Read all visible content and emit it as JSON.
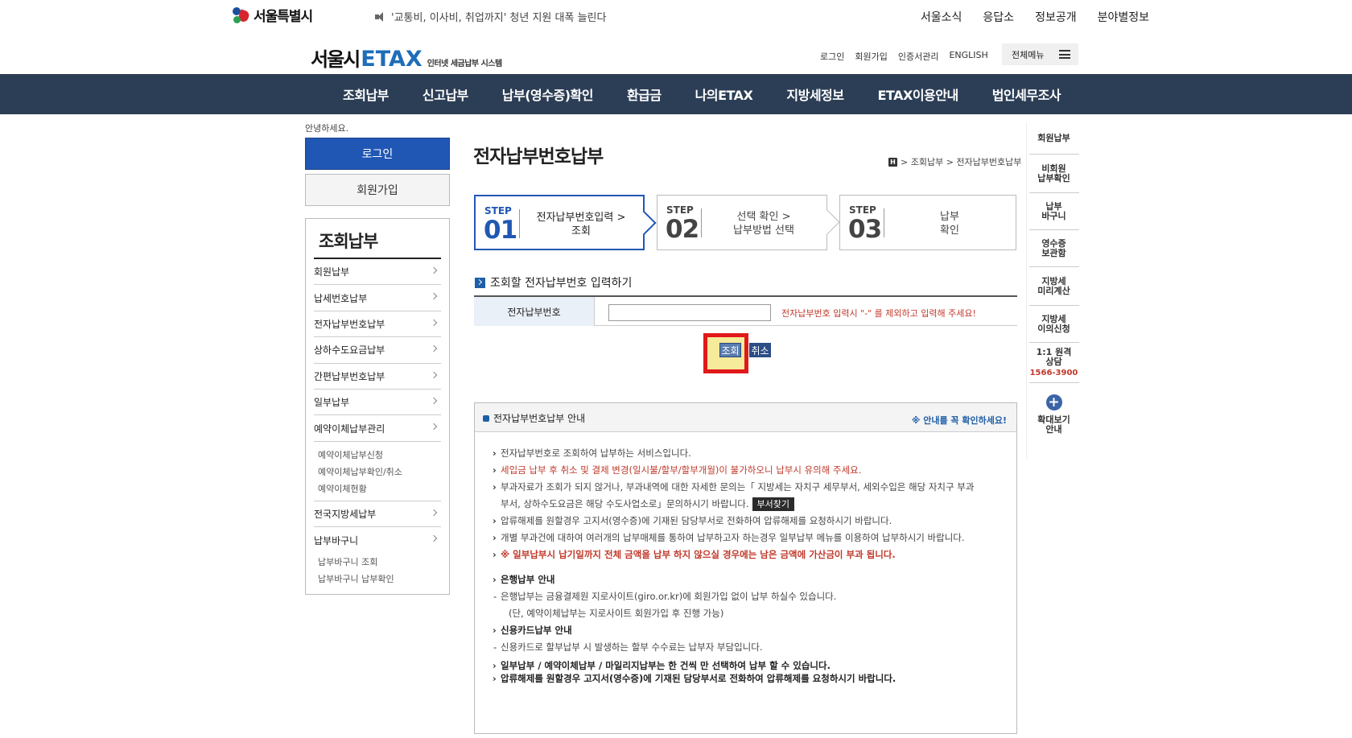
{
  "top": {
    "logo": "서울특별시",
    "notice": "'교통비, 이사비, 취업까지' 청년 지원 대폭 늘린다",
    "links": [
      "서울소식",
      "응답소",
      "정보공개",
      "분야별정보"
    ]
  },
  "header": {
    "logo_k": "서울시",
    "logo_e": "ETAX",
    "logo_sub": "인터넷 세금납부 시스템",
    "util": [
      "로그인",
      "회원가입",
      "인증서관리",
      "ENGLISH"
    ],
    "allmenu": "전체메뉴"
  },
  "gnb": [
    "조회납부",
    "신고납부",
    "납부(영수증)확인",
    "환급금",
    "나의ETAX",
    "지방세정보",
    "ETAX이용안내",
    "법인세무조사"
  ],
  "left": {
    "hello": "안녕하세요.",
    "login": "로그인",
    "join": "회원가입",
    "title": "조회납부",
    "items": [
      "회원납부",
      "납세번호납부",
      "전자납부번호납부",
      "상하수도요금납부",
      "간편납부번호납부",
      "일부납부",
      "예약이체납부관리"
    ],
    "sub1": [
      "예약이체납부신청",
      "예약이체납부확인/취소",
      "예약이체현황"
    ],
    "items2": [
      "전국지방세납부",
      "납부바구니"
    ],
    "sub2": [
      "납부바구니 조회",
      "납부바구니 납부확인"
    ]
  },
  "main": {
    "title": "전자납부번호납부",
    "breadcrumb": [
      "H",
      "> 조회납부 > 전자납부번호납부"
    ],
    "steps": [
      {
        "label": "STEP",
        "num": "01",
        "line1": "전자납부번호입력 >",
        "line2": "조회"
      },
      {
        "label": "STEP",
        "num": "02",
        "line1": "선택 확인 >",
        "line2": "납부방법 선택"
      },
      {
        "label": "STEP",
        "num": "03",
        "line1": "납부",
        "line2": "확인"
      }
    ],
    "section": "조회할 전자납부번호 입력하기",
    "field_label": "전자납부번호",
    "field_value": "",
    "hint": "전자납부번호 입력시 \"-\" 를 제외하고 입력해 주세요!",
    "search": "조회",
    "cancel": "취소"
  },
  "guide": {
    "title": "전자납부번호납부 안내",
    "warn": "※ 안내를 꼭 확인하세요!",
    "l1": "전자납부번호로 조회하여 납부하는 서비스입니다.",
    "l2": "세입금 납부 후 취소 및 결제 변경(일시불/할부/할부개월)이 불가하오니 납부시 유의해 주세요.",
    "l3a": "부과자료가 조회가 되지 않거나, 부과내역에 대한 자세한 문의는「 지방세는 자치구 세무부서, 세외수입은 해당 자치구 부과",
    "l3b": "부서, 상하수도요금은 해당 수도사업소로」문의하시기 바랍니다.",
    "l3btn": "부서찾기",
    "l4": "압류해제를 원할경우 고지서(영수증)에 기재된 담당부서로 전화하여 압류해제를 요청하시기 바랍니다.",
    "l5": "개별 부과건에 대하여 여러개의 납부매체를 통하여 납부하고자 하는경우 일부납부 메뉴를 이용하여 납부하시기 바랍니다.",
    "l6": "※ 일부납부시 납기일까지 전체 금액을 납부 하지 않으실 경우에는 남은 금액에 가산금이 부과 됩니다.",
    "bank_t": "은행납부 안내",
    "bank_1": "은행납부는 금융결제원 지로사이트(giro.or.kr)에 회원가입 없이 납부 하실수 있습니다.",
    "bank_2": "(단, 예약이체납부는 지로사이트 회원가입 후 진행 가능)",
    "card_t": "신용카드납부 안내",
    "card_1": "신용카드로 할부납부 시 발생하는 할부 수수료는 납부자 부담입니다.",
    "f1": "일부납부 / 예약이체납부 / 마일리지납부는 한 건씩 만 선택하여 납부 할 수 있습니다.",
    "f2": "압류해제를 원할경우 고지서(영수증)에 기재된 담당부서로 전화하여 압류해제를 요청하시기 바랍니다."
  },
  "quick": {
    "q1": "회원납부",
    "q2a": "비회원",
    "q2b": "납부확인",
    "q3a": "납부",
    "q3b": "바구니",
    "q4a": "영수증",
    "q4b": "보관함",
    "q5a": "지방세",
    "q5b": "미리계산",
    "q6a": "지방세",
    "q6b": "이의신청",
    "q7a": "1:1 원격",
    "q7b": "상담",
    "q7c": "1566-3900",
    "q8a": "확대보기",
    "q8b": "안내"
  },
  "colors": {
    "gnb_bg": "#2c3e55",
    "accent": "#2157b4",
    "highlight": "#e1191a"
  }
}
